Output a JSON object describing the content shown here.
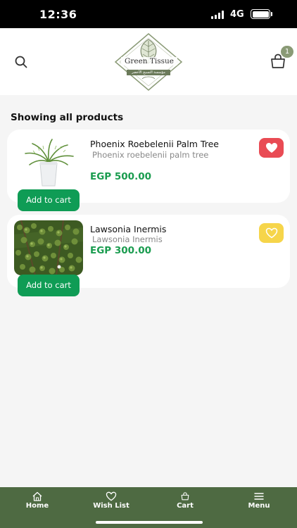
{
  "status_bar": {
    "time": "12:36",
    "network": "4G"
  },
  "header": {
    "logo_title": "Green Tissue",
    "logo_subtitle": "مؤسسة النسيج الأخضر",
    "cart_badge": "1",
    "search_icon": "search-icon",
    "cart_icon": "shopping-bag-icon"
  },
  "main": {
    "section_title": "Showing all products",
    "products": [
      {
        "name": "Phoenix Roebelenii Palm Tree",
        "subtitle": "Phoenix roebelenii palm tree",
        "price": "EGP 500.00",
        "add_label": "Add to cart",
        "wishlisted": true
      },
      {
        "name": "Lawsonia Inermis",
        "subtitle": "Lawsonia Inermis",
        "price": "EGP 300.00",
        "add_label": "Add to cart",
        "wishlisted": false
      }
    ]
  },
  "bottom_nav": {
    "items": [
      {
        "label": "Home",
        "icon": "home-icon"
      },
      {
        "label": "Wish List",
        "icon": "heart-icon"
      },
      {
        "label": "Cart",
        "icon": "shopping-bag-icon"
      },
      {
        "label": "Menu",
        "icon": "menu-icon"
      }
    ]
  },
  "colors": {
    "accent_green": "#0f9c55",
    "price_green": "#1a9c4f",
    "nav_background": "#4e6a42",
    "wish_active": "#e94b54",
    "wish_inactive": "#f6d54a",
    "badge": "#8a9a76"
  }
}
